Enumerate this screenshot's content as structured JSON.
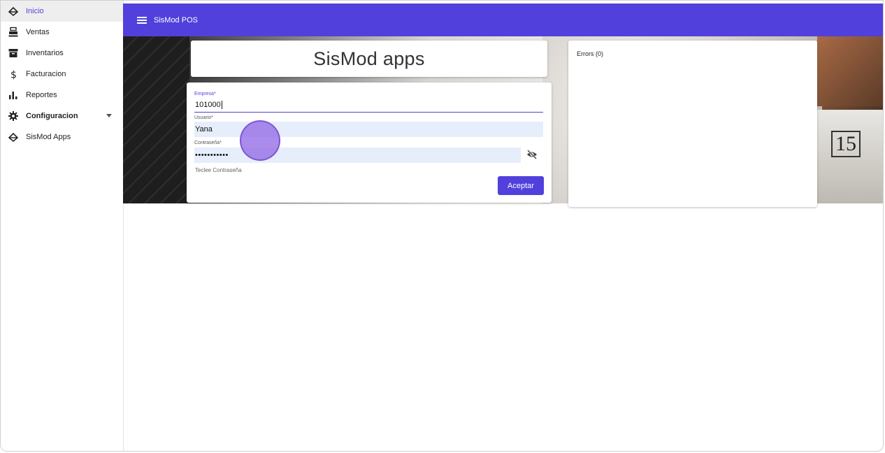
{
  "sidebar": {
    "items": [
      {
        "label": "Inicio",
        "icon": "home-diamond-icon",
        "active": true
      },
      {
        "label": "Ventas",
        "icon": "cash-register-icon"
      },
      {
        "label": "Inventarios",
        "icon": "archive-box-icon"
      },
      {
        "label": "Facturacion",
        "icon": "dollar-icon"
      },
      {
        "label": "Reportes",
        "icon": "bar-chart-icon"
      },
      {
        "label": "Configuracion",
        "icon": "gear-icon",
        "has_submenu": true
      },
      {
        "label": "SisMod Apps",
        "icon": "home-diamond-icon"
      }
    ]
  },
  "topbar": {
    "title": "SisMod POS"
  },
  "main": {
    "app_title": "SisMod apps"
  },
  "login": {
    "empresa_label": "Empresa*",
    "empresa_value": "101000",
    "usuario_label": "Usuario*",
    "usuario_value": "Yana",
    "password_label": "Contraseña*",
    "password_value": "•••••••••••",
    "hint": "Teclee Contraseña",
    "submit_label": "Aceptar"
  },
  "errors": {
    "title": "Errors (0)"
  },
  "hero": {
    "paper_number": "15"
  },
  "colors": {
    "accent": "#5140dc",
    "active_text": "#5a3fd6",
    "input_bg": "#e6eefb"
  }
}
